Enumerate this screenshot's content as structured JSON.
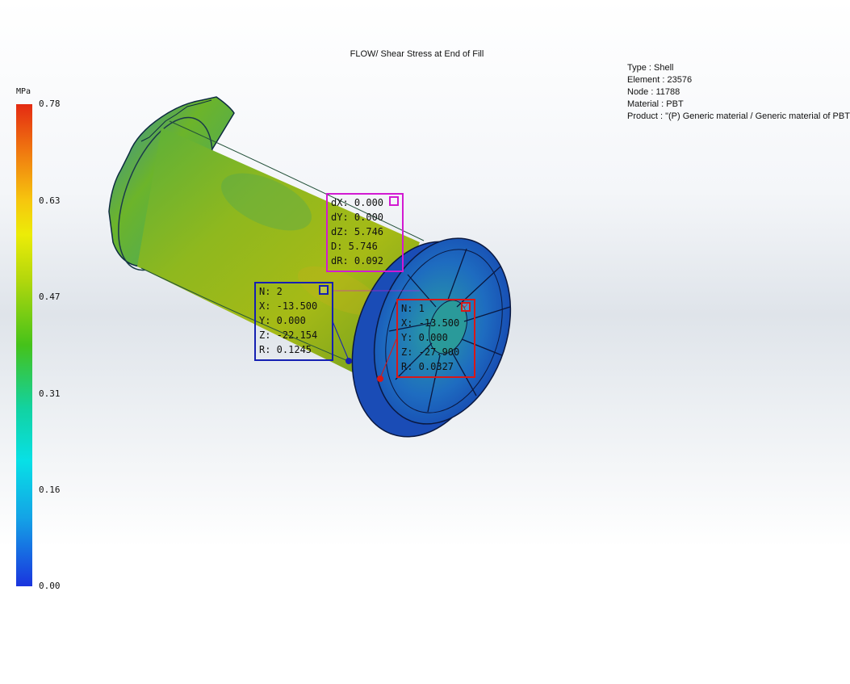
{
  "plot": {
    "title": "FLOW/ Shear Stress at End of Fill"
  },
  "info": {
    "type": "Type : Shell",
    "element": "Element : 23576",
    "node": "Node : 11788",
    "material": "Material : PBT",
    "product": "Product :   \"(P)  Generic material / Generic material of PBT"
  },
  "legend": {
    "unit": "MPa",
    "ticks": [
      "0.78",
      "0.63",
      "0.47",
      "0.31",
      "0.16",
      "0.00"
    ],
    "colors": [
      "#e42a12",
      "#f07a10",
      "#f6c60e",
      "#ecec08",
      "#45c21a",
      "#12d2a0",
      "#08e0e6",
      "#1a34de"
    ]
  },
  "measure": {
    "lines": [
      "dX: 0.000",
      "dY: 0.000",
      "dZ: 5.746",
      "D: 5.746",
      "dR: 0.092"
    ],
    "color": "#d21ad2"
  },
  "probe2": {
    "lines": [
      "N: 2",
      "X: -13.500",
      "Y: 0.000",
      "Z: -22.154",
      "R: 0.1245"
    ],
    "color": "#1520b2"
  },
  "probe1": {
    "lines": [
      "N: 1",
      "X: -13.500",
      "Y: 0.000",
      "Z: -27.900",
      "R: 0.0327"
    ],
    "check": "✓",
    "color": "#d81818"
  }
}
